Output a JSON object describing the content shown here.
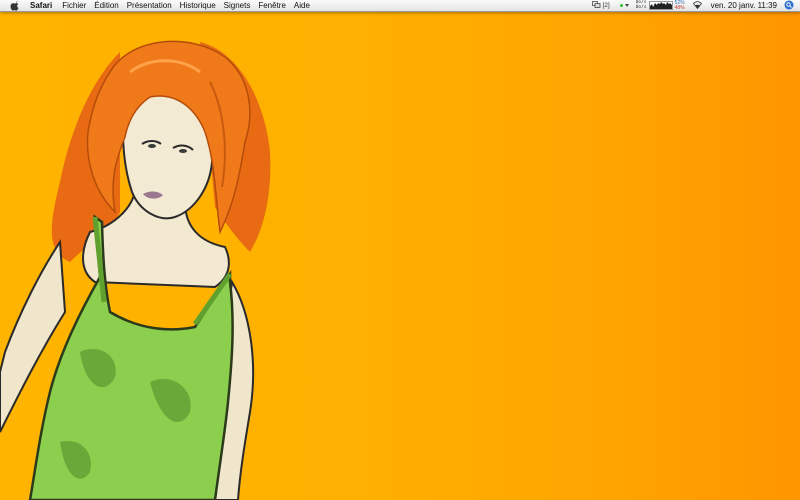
{
  "menubar": {
    "apple_icon": "apple-logo-icon",
    "app_name": "Safari",
    "items": [
      "Fichier",
      "Édition",
      "Présentation",
      "Historique",
      "Signets",
      "Fenêtre",
      "Aide"
    ],
    "tray": {
      "spaces_icon": "spaces-icon",
      "spaces_count": "[2]",
      "status_dot_color": "#2fbf2f",
      "net_up": "0o/s",
      "net_down": "0o/s",
      "cpu_graph_icon": "cpu-graph-icon",
      "cpu_user_pct": "52%",
      "cpu_sys_pct": "48%",
      "wifi_icon": "wifi-icon",
      "clock": "ven. 20 janv. 11:39",
      "spotlight_icon": "spotlight-search-icon"
    }
  },
  "desktop": {
    "background_colors": [
      "#ffb400",
      "#ff9500"
    ],
    "wallpaper_subject": "illustration-woman-red-hair-green-top"
  }
}
